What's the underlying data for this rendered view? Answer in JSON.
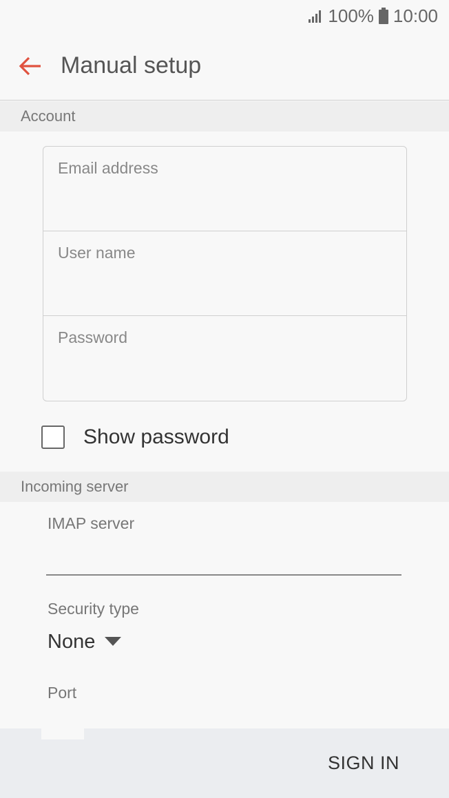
{
  "status_bar": {
    "battery_percent": "100%",
    "time": "10:00",
    "signal_icon": "signal-icon",
    "battery_icon": "battery-icon"
  },
  "app_bar": {
    "title": "Manual setup",
    "back_icon": "arrow-left-icon",
    "accent_color": "#e0523f"
  },
  "sections": {
    "account": "Account",
    "incoming_server": "Incoming server"
  },
  "account_form": {
    "email_placeholder": "Email address",
    "username_placeholder": "User name",
    "password_placeholder": "Password"
  },
  "show_password": {
    "label": "Show password",
    "checked": false
  },
  "incoming": {
    "imap_label": "IMAP server",
    "imap_value": "",
    "security_label": "Security type",
    "security_value": "None",
    "port_label": "Port"
  },
  "footer": {
    "sign_in_label": "SIGN IN"
  }
}
